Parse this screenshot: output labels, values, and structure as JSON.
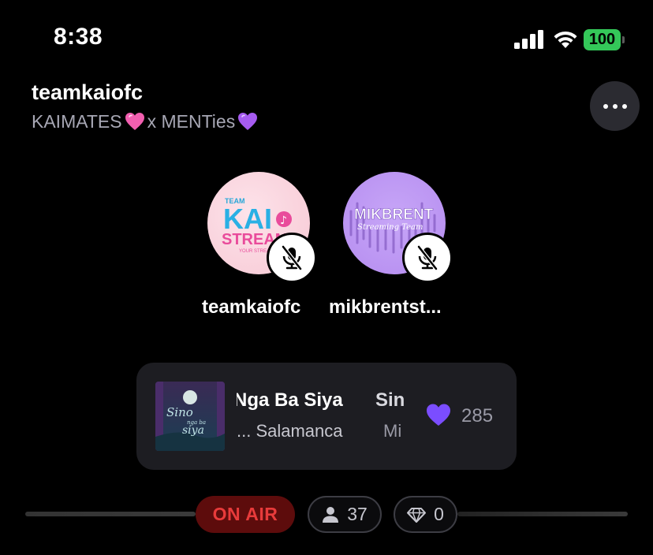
{
  "status_bar": {
    "time": "8:38",
    "battery_level": "100",
    "battery_color": "#34c759"
  },
  "room": {
    "host_name": "teamkaiofc",
    "subtitle_part1": "KAIMATES",
    "subtitle_part2": " x MENTies",
    "heart_1_color": "#f25fb0",
    "heart_2_color": "#a65bf0",
    "more_icon": "ellipsis-icon"
  },
  "speakers": [
    {
      "name": "teamkaiofc",
      "avatar_line1": "TEAM",
      "avatar_line2": "KAI",
      "avatar_line3": "STREAM",
      "avatar_line4": "YOUR STREAM",
      "muted_icon": "mic-off-icon"
    },
    {
      "name": "mikbrentst...",
      "avatar_line1": "MIKBRENT",
      "avatar_line2": "Streaming Team",
      "muted_icon": "mic-off-icon"
    }
  ],
  "now_playing": {
    "title_a": "Nga Ba Siya",
    "title_b": "Sin",
    "artist_a": "... Salamanca",
    "artist_b": "Mi",
    "cover_text_1": "Sino",
    "cover_text_2": "nga ba",
    "cover_text_3": "siya",
    "like_count": "285",
    "like_color": "#7b4dff"
  },
  "footer": {
    "on_air_label": "ON AIR",
    "listener_count": "37",
    "gem_count": "0",
    "on_air_color": "#e83b3b"
  }
}
